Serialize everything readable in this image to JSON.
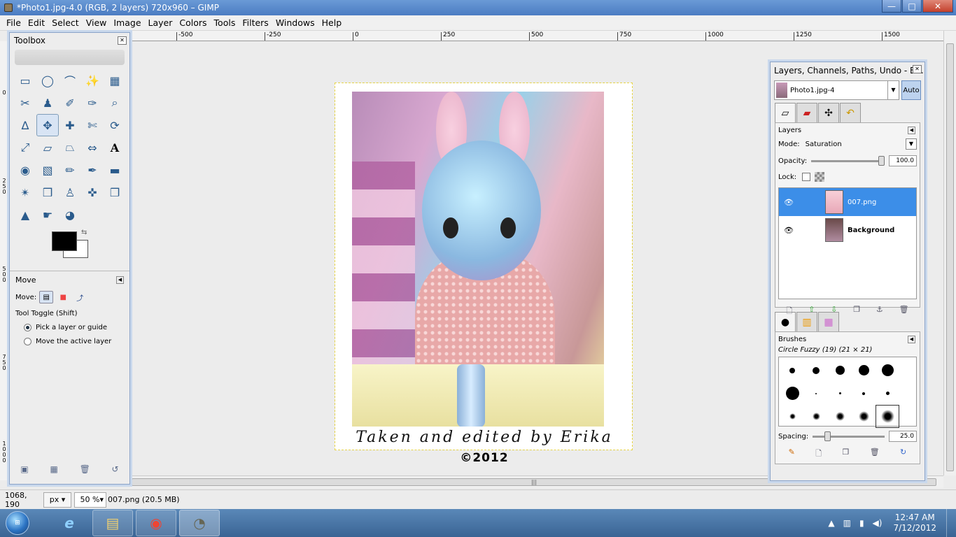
{
  "window": {
    "title": "*Photo1.jpg-4.0 (RGB, 2 layers) 720x960 – GIMP",
    "min": "—",
    "max": "□",
    "close": "✕"
  },
  "menu": [
    "File",
    "Edit",
    "Select",
    "View",
    "Image",
    "Layer",
    "Colors",
    "Tools",
    "Filters",
    "Windows",
    "Help"
  ],
  "hruler": [
    "-500",
    "-250",
    "0",
    "250",
    "500",
    "750",
    "1000",
    "1250",
    "1500"
  ],
  "vruler": [
    "0",
    "250",
    "500",
    "750",
    "1000"
  ],
  "image": {
    "caption": "Taken and edited by Erika",
    "copyright": "©2012"
  },
  "toolbox": {
    "title": "Toolbox",
    "tools": [
      {
        "name": "rect-select-icon",
        "g": "▭"
      },
      {
        "name": "ellipse-select-icon",
        "g": "◯"
      },
      {
        "name": "lasso-icon",
        "g": "⌒"
      },
      {
        "name": "fuzzy-select-icon",
        "g": "✨"
      },
      {
        "name": "color-select-icon",
        "g": "▦"
      },
      {
        "name": "scissors-icon",
        "g": "✂"
      },
      {
        "name": "foreground-select-icon",
        "g": "♟"
      },
      {
        "name": "paths-icon",
        "g": "✐"
      },
      {
        "name": "color-picker-icon",
        "g": "✑"
      },
      {
        "name": "zoom-icon",
        "g": "⌕"
      },
      {
        "name": "measure-icon",
        "g": "∆"
      },
      {
        "name": "move-icon",
        "g": "✥"
      },
      {
        "name": "align-icon",
        "g": "✚"
      },
      {
        "name": "crop-icon",
        "g": "✄"
      },
      {
        "name": "rotate-icon",
        "g": "⟳"
      },
      {
        "name": "scale-icon",
        "g": "⤢"
      },
      {
        "name": "shear-icon",
        "g": "▱"
      },
      {
        "name": "perspective-icon",
        "g": "⏢"
      },
      {
        "name": "flip-icon",
        "g": "⇔"
      },
      {
        "name": "text-icon",
        "g": "A"
      },
      {
        "name": "bucket-fill-icon",
        "g": "◉"
      },
      {
        "name": "gradient-icon",
        "g": "▧"
      },
      {
        "name": "pencil-icon",
        "g": "✏"
      },
      {
        "name": "paintbrush-icon",
        "g": "✒"
      },
      {
        "name": "eraser-icon",
        "g": "▬"
      },
      {
        "name": "airbrush-icon",
        "g": "✴"
      },
      {
        "name": "ink-icon",
        "g": "❒"
      },
      {
        "name": "clone-icon",
        "g": "♙"
      },
      {
        "name": "heal-icon",
        "g": "✜"
      },
      {
        "name": "perspective-clone-icon",
        "g": "❐"
      },
      {
        "name": "blur-icon",
        "g": "▲"
      },
      {
        "name": "smudge-icon",
        "g": "☛"
      },
      {
        "name": "dodge-burn-icon",
        "g": "◕"
      }
    ],
    "options": {
      "title": "Move",
      "move_label": "Move:",
      "toggle": "Tool Toggle  (Shift)",
      "radio1": "Pick a layer or guide",
      "radio2": "Move the active layer"
    }
  },
  "dock": {
    "title": "Layers, Channels, Paths, Undo - Br...",
    "image_select": "Photo1.jpg-4",
    "auto": "Auto",
    "layers": {
      "title": "Layers",
      "mode_label": "Mode:",
      "mode": "Saturation",
      "opacity_label": "Opacity:",
      "opacity": "100.0",
      "opacity_level": 1.0,
      "lock_label": "Lock:",
      "items": [
        {
          "name": "007.png",
          "selected": true
        },
        {
          "name": "Background",
          "selected": false
        }
      ]
    },
    "brushes": {
      "title": "Brushes",
      "current": "Circle Fuzzy (19) (21 × 21)",
      "spacing_label": "Spacing:",
      "spacing": "25.0",
      "spacing_level": 0.25
    }
  },
  "status": {
    "coords": "1068, 190",
    "unit": "px",
    "zoom": "50 %",
    "info": "007.png (20.5 MB)"
  },
  "taskbar": {
    "time": "12:47 AM",
    "date": "7/12/2012"
  }
}
